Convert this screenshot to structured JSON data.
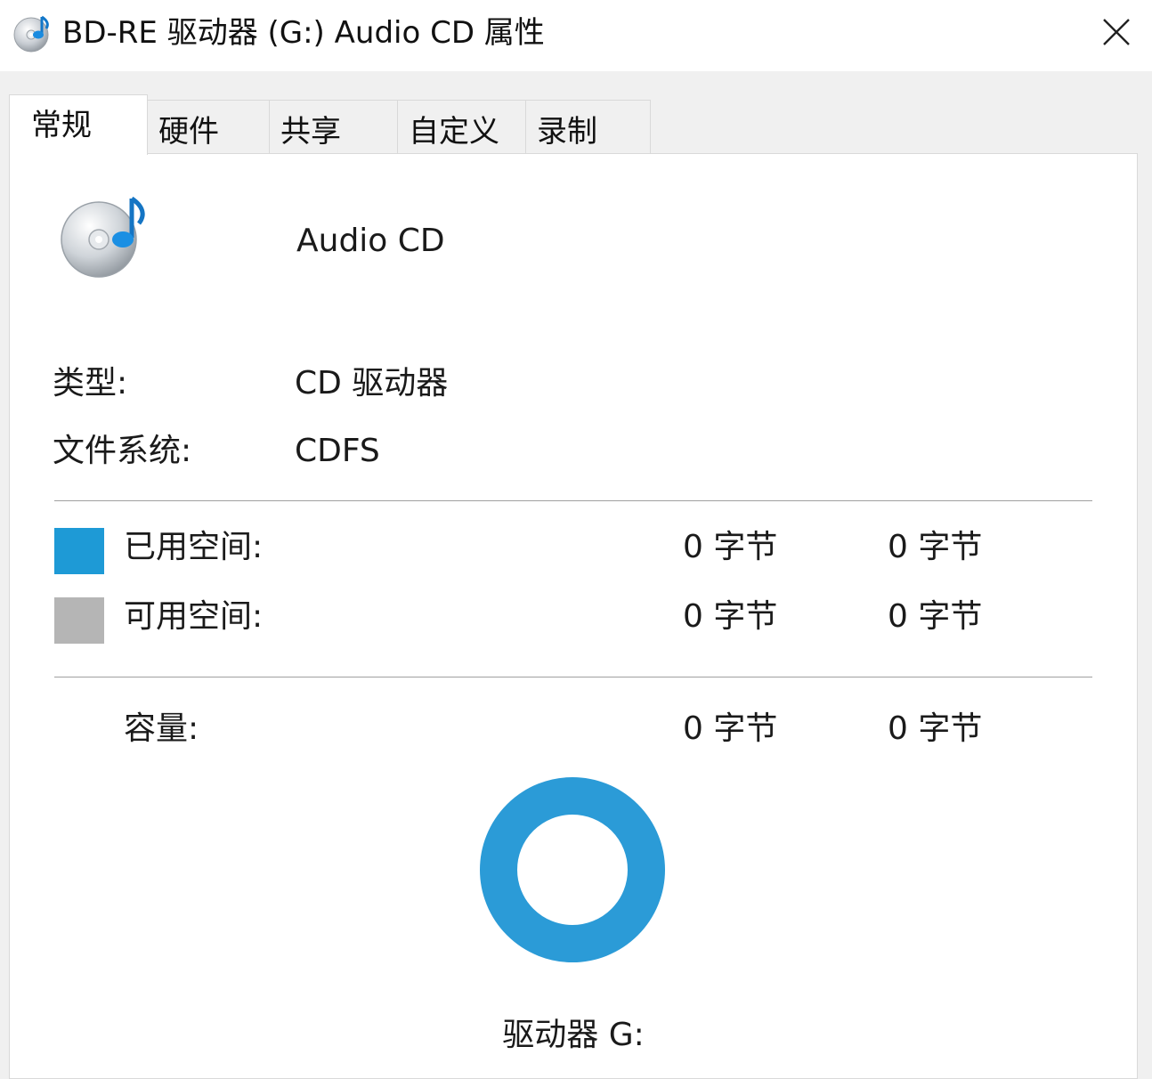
{
  "window": {
    "title": "BD-RE 驱动器 (G:) Audio CD 属性",
    "icon": "audio-cd-icon",
    "close_icon": "close-icon"
  },
  "tabs": [
    {
      "label": "常规",
      "active": true
    },
    {
      "label": "硬件",
      "active": false
    },
    {
      "label": "共享",
      "active": false
    },
    {
      "label": "自定义",
      "active": false
    },
    {
      "label": "录制",
      "active": false
    }
  ],
  "general": {
    "drive_name": "Audio CD",
    "type_label": "类型:",
    "type_value": "CD 驱动器",
    "fs_label": "文件系统:",
    "fs_value": "CDFS",
    "used": {
      "label": "已用空间:",
      "bytes": "0 字节",
      "size": "0 字节",
      "color": "#1e9ad6"
    },
    "free": {
      "label": "可用空间:",
      "bytes": "0 字节",
      "size": "0 字节",
      "color": "#b5b5b5"
    },
    "capacity": {
      "label": "容量:",
      "bytes": "0 字节",
      "size": "0 字节"
    },
    "drive_letter": "驱动器 G:",
    "donut_color": "#2b9bd7"
  }
}
